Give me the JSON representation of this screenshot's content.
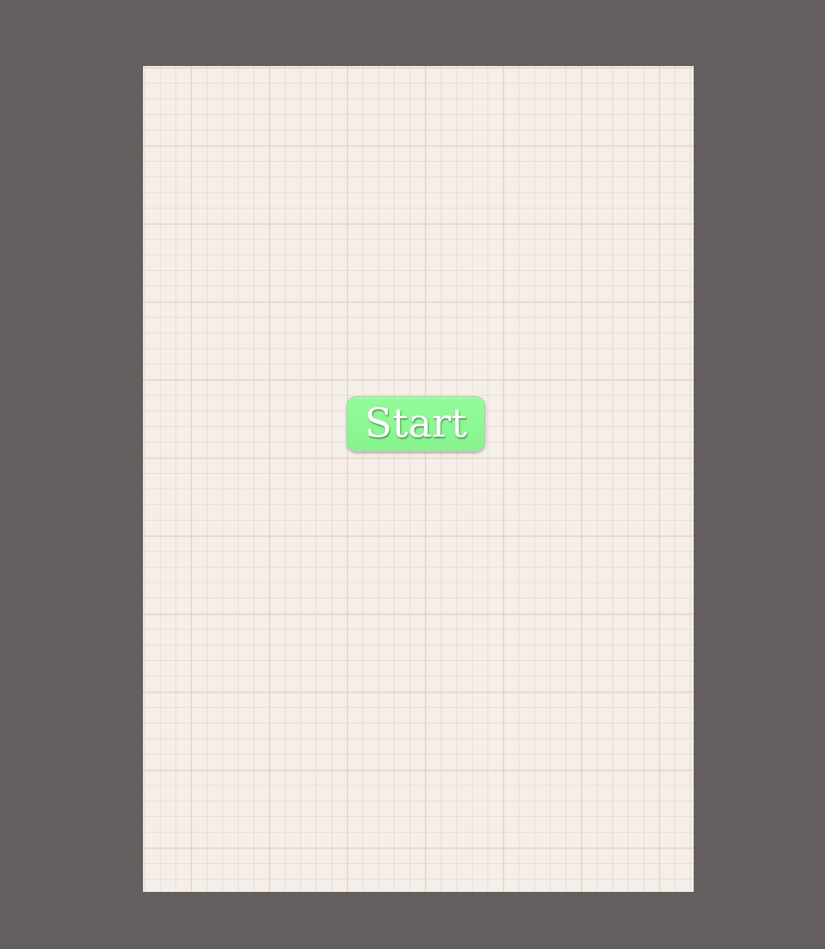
{
  "game": {
    "start_button_label": "Start"
  },
  "colors": {
    "backdrop": "#645e5e",
    "paper": "#f5efe9",
    "grid_line": "#e2c4aa",
    "button": "#8ff896",
    "button_text": "#ffffff"
  }
}
